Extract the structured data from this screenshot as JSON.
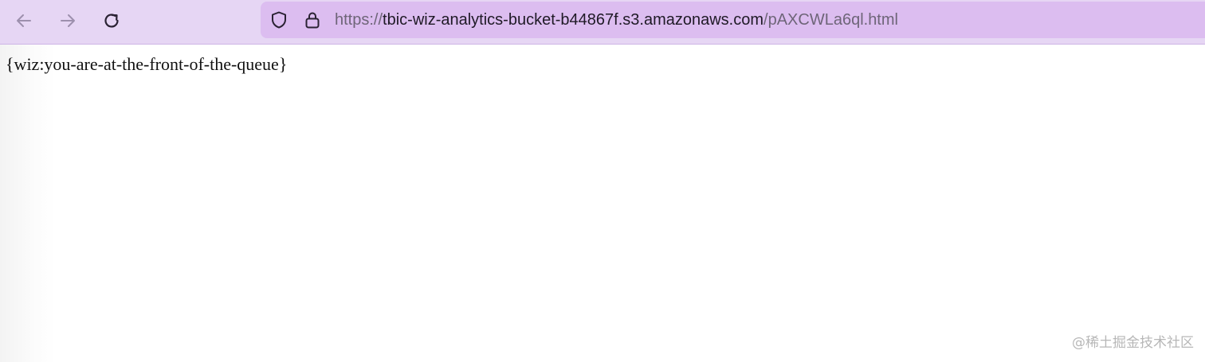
{
  "browser": {
    "colors": {
      "toolbar": "#e6d6f4",
      "urlbar": "#dcbdf0",
      "icon_disabled": "#9d90ad",
      "icon_active": "#2a2233"
    },
    "nav": {
      "back_icon": "arrow-left-icon",
      "forward_icon": "arrow-right-icon",
      "reload_icon": "reload-icon"
    },
    "urlbar": {
      "security_icon": "shield-icon",
      "lock_icon": "lock-icon",
      "scheme": "https://",
      "host": "tbic-wiz-analytics-bucket-b44867f.s3.amazonaws.com",
      "path": "/pAXCWLa6ql.html"
    }
  },
  "page": {
    "body_text": "{wiz:you-are-at-the-front-of-the-queue}"
  },
  "watermark": {
    "text": "@稀土掘金技术社区"
  }
}
